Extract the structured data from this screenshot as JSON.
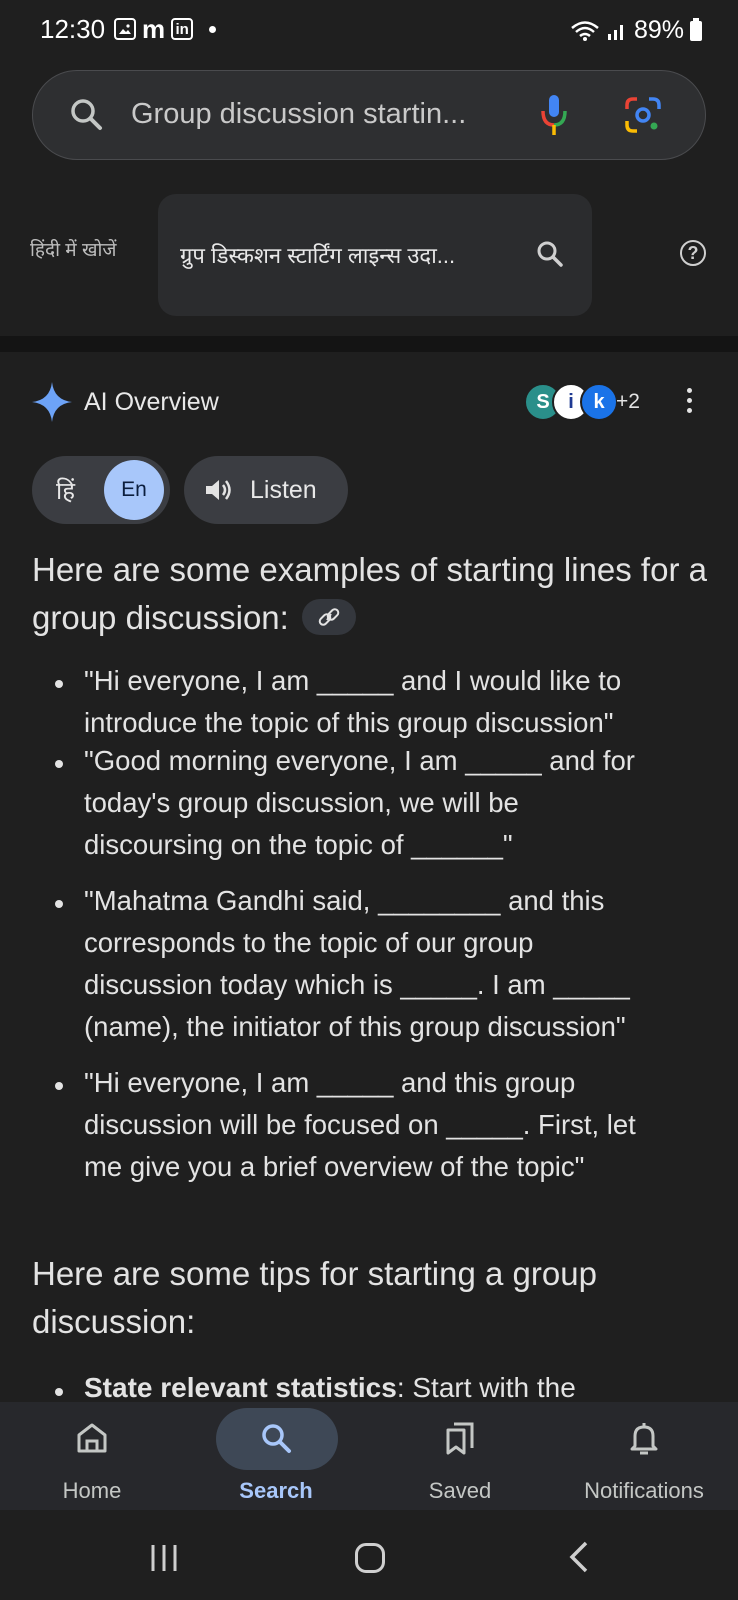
{
  "status_bar": {
    "time": "12:30",
    "app_icons": [
      "gallery-icon",
      "m-app-icon",
      "linkedin-icon"
    ],
    "linkedin_text": "in",
    "m_text": "m",
    "battery": "89%"
  },
  "search": {
    "query": "Group discussion startin..."
  },
  "hindi_search": {
    "label": "हिंदी में खोजें",
    "query": "ग्रुप डिस्कशन स्टार्टिंग लाइन्स उदा..."
  },
  "ai_overview": {
    "title": "AI Overview",
    "source_count": "+2",
    "sources": [
      {
        "letter": "S",
        "color": "#2a8f8a"
      },
      {
        "letter": "i",
        "color": "#ffffff"
      },
      {
        "letter": "k",
        "color": "#1a73e8"
      }
    ],
    "lang_hi": "हिं",
    "lang_en": "En",
    "listen_label": "Listen",
    "intro": "Here are some examples of starting lines for a group discussion:",
    "examples": [
      "\"Hi everyone, I am _____ and I would like to\nintroduce the topic of this group discussion\"",
      "\"Good morning everyone, I am _____ and for\ntoday's group discussion, we will be\ndiscoursing on the topic of ______\"",
      "\"Mahatma Gandhi said, ________ and this\ncorresponds to the topic of our group\ndiscussion today which is _____. I am _____\n(name), the initiator of this group discussion\"",
      "\"Hi everyone, I am _____ and this group\ndiscussion will be focused on _____. First, let\nme give you a brief overview of the topic\""
    ],
    "tips_heading": "Here are some tips for starting a group discussion:",
    "tip_first_bold": "State relevant statistics",
    "tip_first_rest": ": Start with the"
  },
  "bottom_nav": {
    "items": [
      {
        "label": "Home",
        "icon": "home-icon"
      },
      {
        "label": "Search",
        "icon": "search-icon",
        "active": true
      },
      {
        "label": "Saved",
        "icon": "bookmarks-icon"
      },
      {
        "label": "Notifications",
        "icon": "bell-icon"
      }
    ]
  }
}
